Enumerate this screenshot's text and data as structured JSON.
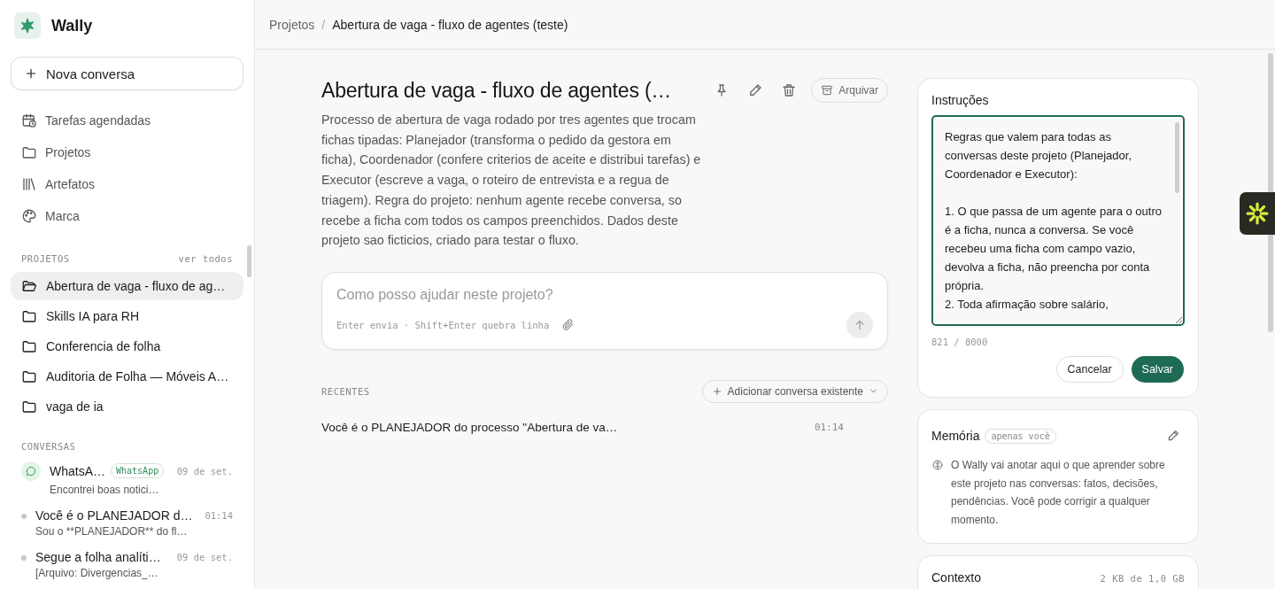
{
  "app": {
    "name": "Wally"
  },
  "sidebar": {
    "new_button": "Nova conversa",
    "nav": [
      {
        "kind": "schedule",
        "label": "Tarefas agendadas"
      },
      {
        "kind": "folder",
        "label": "Projetos"
      },
      {
        "kind": "library",
        "label": "Artefatos"
      },
      {
        "kind": "palette",
        "label": "Marca"
      }
    ],
    "projects_heading": "PROJETOS",
    "projects_link": "ver todos",
    "projects": [
      {
        "label": "Abertura de vaga - fluxo de ag…",
        "selected": true
      },
      {
        "label": "Skills IA para RH",
        "selected": false
      },
      {
        "label": "Conferencia de folha",
        "selected": false
      },
      {
        "label": "Auditoria de Folha — Móveis A…",
        "selected": false
      },
      {
        "label": "vaga de ia",
        "selected": false
      }
    ],
    "conversations_heading": "CONVERSAS",
    "conversations": [
      {
        "kind": "whatsapp",
        "title": "WhatsA…",
        "badge": "WhatsApp",
        "time": "09 de set.",
        "preview": "Encontrei boas notici…"
      },
      {
        "kind": "chat",
        "title": "Você é o PLANEJADOR d…",
        "time": "01:14",
        "preview": "Sou o **PLANEJADOR** do fl…"
      },
      {
        "kind": "chat",
        "title": "Segue a folha analíti…",
        "time": "09 de set.",
        "preview": "[Arquivo: Divergencias_…"
      }
    ]
  },
  "breadcrumb": {
    "root": "Projetos",
    "separator": "/",
    "current": "Abertura de vaga - fluxo de agentes (teste)"
  },
  "project": {
    "title": "Abertura de vaga - fluxo de agentes (…",
    "archive_button": "Arquivar",
    "description": "Processo de abertura de vaga rodado por tres agentes que trocam fichas tipadas: Planejador (transforma o pedido da gestora em ficha), Coordenador (confere criterios de aceite e distribui tarefas) e Executor (escreve a vaga, o roteiro de entrevista e a regua de triagem). Regra do projeto: nenhum agente recebe conversa, so recebe a ficha com todos os campos preenchidos. Dados deste projeto sao ficticios, criado para testar o fluxo.",
    "composer": {
      "placeholder": "Como posso ajudar neste projeto?",
      "hint": "Enter envia · Shift+Enter quebra linha"
    },
    "recents_heading": "RECENTES",
    "add_button": "Adicionar conversa existente",
    "recents": [
      {
        "title": "Você é o PLANEJADOR do processo \"Abertura de va…",
        "time": "01:14"
      }
    ]
  },
  "instructions": {
    "title": "Instruções",
    "value": "Regras que valem para todas as conversas deste projeto (Planejador, Coordenador e Executor):\n\n1. O que passa de um agente para o outro é a ficha, nunca a conversa. Se você recebeu uma ficha com campo vazio, devolva a ficha, não preencha por conta própria.\n2. Toda afirmação sobre salário,",
    "counter": "821 / 8000",
    "cancel": "Cancelar",
    "save": "Salvar"
  },
  "memory": {
    "title": "Memória",
    "badge": "apenas você",
    "text": "O Wally vai anotar aqui o que aprender sobre este projeto nas conversas: fatos, decisões, pendências. Você pode corrigir a qualquer momento."
  },
  "context": {
    "title": "Contexto",
    "usage": "2 KB de 1,0 GB"
  }
}
